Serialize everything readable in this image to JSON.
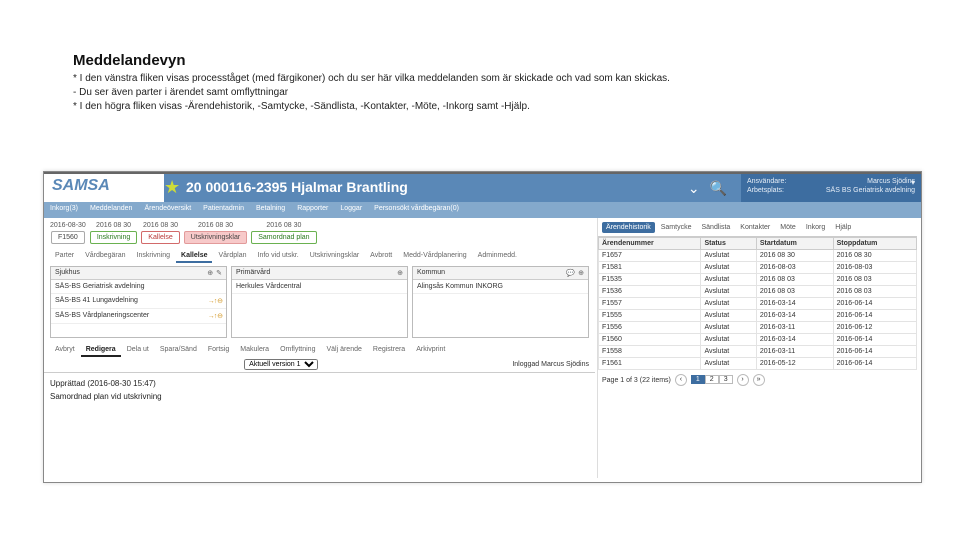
{
  "slide": {
    "heading": "Meddelandevyn",
    "b1": "* I den vänstra fliken visas procesståget (med färgikoner) och du ser här vilka meddelanden som är skickade och vad som kan skickas.",
    "b2": "  - Du ser även parter i ärendet samt omflyttningar",
    "b3": "* I den högra fliken visas -Ärendehistorik, -Samtycke, -Sändlista, -Kontakter, -Möte, -Inkorg samt -Hjälp."
  },
  "header": {
    "brand": "SAMSA",
    "patient": "20 000116-2395 Hjalmar Brantling",
    "meta_user_label": "Ansvändare:",
    "meta_user": "Marcus Sjödins",
    "meta_place_label": "Arbetsplats:",
    "meta_place": "SÄS BS Geriatrisk avdelning"
  },
  "nav": [
    "Inkorg(3)",
    "Meddelanden",
    "Ärendeöversikt",
    "Patientadmin",
    "Betalning",
    "Rapporter",
    "Loggar",
    "Personsökt vårdbegäran(0)"
  ],
  "timeline": [
    {
      "date": "2016-08-30",
      "label": "F1560",
      "cls": "tl-box"
    },
    {
      "date": "2016 08 30",
      "label": "Inskrivning",
      "cls": "tl-box tl-green"
    },
    {
      "date": "2016 08 30",
      "label": "Kallelse",
      "cls": "tl-box tl-red"
    },
    {
      "date": "2016 08 30",
      "label": "Utskrivningsklar",
      "cls": "tl-box tl-pink"
    },
    {
      "date": "2016 08 30",
      "label": "Samordnad plan",
      "cls": "tl-box tl-green"
    }
  ],
  "subtabs": [
    "Parter",
    "Vårdbegäran",
    "Inskrivning",
    "Kallelse",
    "Vårdplan",
    "Info vid utskr.",
    "Utskrivningsklar",
    "Avbrott",
    "Medd-Vårdplanering",
    "Adminmedd."
  ],
  "subtabs_active": 3,
  "panels": {
    "sjukhus": {
      "title": "Sjukhus",
      "rows": [
        {
          "t": "SÄS-BS Geriatrisk avdelning",
          "a": ""
        },
        {
          "t": "SÄS-BS 41 Lungavdelning",
          "a": "→↑ ⊖"
        },
        {
          "t": "SÄS-BS Vårdplaneringscenter",
          "a": "→↑ ⊖"
        }
      ]
    },
    "primarvard": {
      "title": "Primärvård",
      "rows": [
        {
          "t": "Herkules Vårdcentral",
          "a": ""
        }
      ]
    },
    "kommun": {
      "title": "Kommun",
      "rows": [
        {
          "t": "Alingsås Kommun INKORG",
          "a": ""
        }
      ]
    }
  },
  "det_tabs": [
    "Avbryt",
    "Redigera",
    "Dela ut",
    "Spara/Sänd",
    "Fortsig",
    "Makulera",
    "Omflyttning",
    "Välj ärende",
    "Registrera",
    "Arkivprint"
  ],
  "det_tabs_active": 1,
  "det_bar": {
    "dropdown_label": "Aktuell version 1",
    "logged": "Inloggad Marcus Sjödins"
  },
  "editor": {
    "meta": "Upprättad (2016-08-30 15:47)",
    "content": "Samordnad plan vid utskrivning"
  },
  "right_tabs": [
    "Ärendehistorik",
    "Samtycke",
    "Sändlista",
    "Kontakter",
    "Möte",
    "Inkorg",
    "Hjälp"
  ],
  "right_tabs_active": 0,
  "hist_headers": [
    "Ärendenummer",
    "Status",
    "Startdatum",
    "Stoppdatum"
  ],
  "hist_rows": [
    [
      "F1657",
      "Avslutat",
      "2016 08 30",
      "2016 08 30"
    ],
    [
      "F1581",
      "Avslutat",
      "2016-08-03",
      "2016-08-03"
    ],
    [
      "F1535",
      "Avslutat",
      "2016 08 03",
      "2016 08 03"
    ],
    [
      "F1536",
      "Avslutat",
      "2016 08 03",
      "2016 08 03"
    ],
    [
      "F1557",
      "Avslutat",
      "2016-03-14",
      "2016-06-14"
    ],
    [
      "F1555",
      "Avslutat",
      "2016-03-14",
      "2016-06-14"
    ],
    [
      "F1556",
      "Avslutat",
      "2016-03-11",
      "2016-06-12"
    ],
    [
      "F1560",
      "Avslutat",
      "2016-03-14",
      "2016-06-14"
    ],
    [
      "F1558",
      "Avslutat",
      "2016-03-11",
      "2016-06-14"
    ],
    [
      "F1561",
      "Avslutat",
      "2016-05-12",
      "2016-06-14"
    ]
  ],
  "pager": {
    "summary": "Page 1 of 3 (22 items)",
    "pages": [
      "1",
      "2",
      "3"
    ],
    "cur": 0
  }
}
